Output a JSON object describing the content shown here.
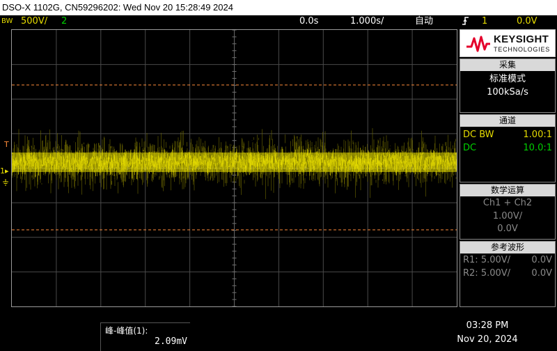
{
  "title_bar": {
    "text": "DSO-X 1102G, CN59296202: Wed Nov 20 15:28:49 2024"
  },
  "top_bar": {
    "bw_label": "BW",
    "ch1_scale": "500V/",
    "ch2_label": "2",
    "time_delay": "0.0s",
    "time_scale": "1.000s/",
    "trigger_mode": "自动",
    "trigger_source": "1",
    "trigger_level": "0.0V"
  },
  "colors": {
    "ch1": "#e6dc00",
    "ch2": "#00d000",
    "cursor": "#ff8c3a",
    "grid": "#4a4a4a"
  },
  "brand": {
    "name": "KEYSIGHT",
    "sub": "TECHNOLOGIES"
  },
  "acquire": {
    "header": "采集",
    "mode": "标准模式",
    "rate": "100kSa/s"
  },
  "channels": {
    "header": "通道",
    "ch1": {
      "coupling": "DC BW",
      "probe": "1.00:1"
    },
    "ch2": {
      "coupling": "DC",
      "probe": "10.0:1"
    }
  },
  "math": {
    "header": "数学运算",
    "function": "Ch1 + Ch2",
    "scale": "1.00V/",
    "offset": "0.0V"
  },
  "reference": {
    "header": "参考波形",
    "r1": {
      "label": "R1:",
      "scale": "5.00V/",
      "offset": "0.0V"
    },
    "r2": {
      "label": "R2:",
      "scale": "5.00V/",
      "offset": "0.0V"
    }
  },
  "markers": {
    "trigger_t": "T",
    "ch1_marker": "1"
  },
  "measurement": {
    "label": "峰-峰值(1):",
    "value": "2.09mV"
  },
  "clock": {
    "time": "03:28 PM",
    "date": "Nov 20, 2024"
  }
}
